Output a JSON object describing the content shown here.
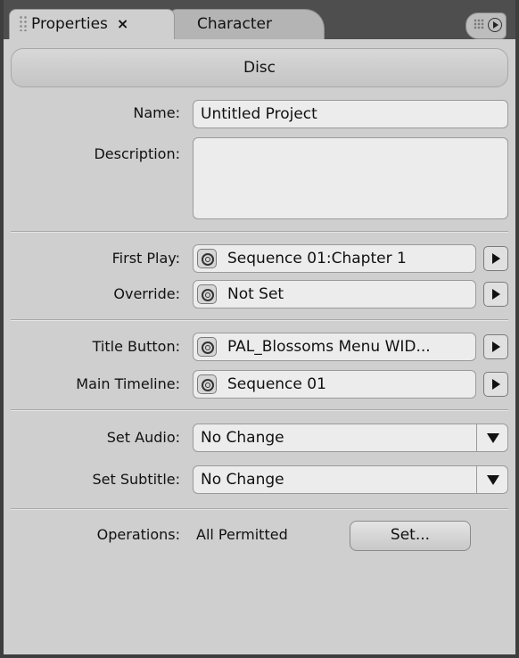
{
  "tabs": {
    "properties": {
      "label": "Properties",
      "close": "×"
    },
    "character": {
      "label": "Character"
    }
  },
  "header": {
    "title": "Disc"
  },
  "fields": {
    "name_label": "Name:",
    "name_value": "Untitled Project",
    "description_label": "Description:",
    "description_value": ""
  },
  "links": {
    "first_play_label": "First Play:",
    "first_play_value": "Sequence 01:Chapter 1",
    "override_label": "Override:",
    "override_value": "Not Set",
    "title_button_label": "Title Button:",
    "title_button_value": "PAL_Blossoms Menu WID...",
    "main_timeline_label": "Main Timeline:",
    "main_timeline_value": "Sequence 01"
  },
  "selects": {
    "audio_label": "Set Audio:",
    "audio_value": "No Change",
    "subtitle_label": "Set Subtitle:",
    "subtitle_value": "No Change"
  },
  "operations": {
    "label": "Operations:",
    "value": "All Permitted",
    "button_label": "Set..."
  }
}
